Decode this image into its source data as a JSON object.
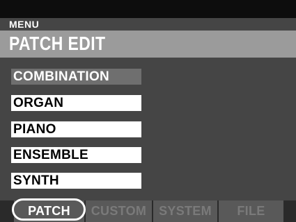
{
  "header": {
    "breadcrumb": "MENU",
    "title": "PATCH EDIT"
  },
  "menu": {
    "items": [
      {
        "label": "COMBINATION",
        "selected": true
      },
      {
        "label": "ORGAN",
        "selected": false
      },
      {
        "label": "PIANO",
        "selected": false
      },
      {
        "label": "ENSEMBLE",
        "selected": false
      },
      {
        "label": "SYNTH",
        "selected": false
      }
    ]
  },
  "tabs": [
    {
      "label": "PATCH",
      "active": true
    },
    {
      "label": "CUSTOM",
      "active": false
    },
    {
      "label": "SYSTEM",
      "active": false
    },
    {
      "label": "FILE",
      "active": false
    }
  ],
  "colors": {
    "screen_bg": "#454545",
    "title_bar": "#9b9b9b",
    "selected_item": "#6f6f6f",
    "tab_bg": "#595959"
  }
}
